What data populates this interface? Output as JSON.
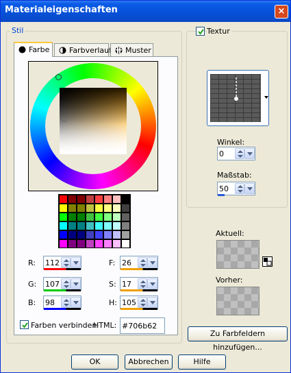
{
  "window": {
    "title": "Materialeigenschaften",
    "close": "×"
  },
  "stil": {
    "legend": "Stil",
    "tabs": [
      {
        "label": "Farbe",
        "icon": "filled-circle-icon"
      },
      {
        "label": "Farbverlauf",
        "icon": "half-circle-icon"
      },
      {
        "label": "Muster",
        "icon": "pattern-icon"
      }
    ],
    "fields": {
      "r": {
        "label": "R:",
        "value": "112",
        "bar": "#ff0000"
      },
      "g": {
        "label": "G:",
        "value": "107",
        "bar": "#00cc00"
      },
      "b": {
        "label": "B:",
        "value": "98",
        "bar": "#0000ff"
      },
      "f": {
        "label": "F:",
        "value": "26",
        "bar": "#f0a000"
      },
      "s": {
        "label": "S:",
        "value": "17",
        "bar": "#f0a000"
      },
      "h": {
        "label": "H:",
        "value": "105",
        "bar": "#f0a000"
      }
    },
    "link_colors": {
      "label": "Farben verbinden",
      "checked": true
    },
    "html": {
      "label": "HTML:",
      "value": "#706b62"
    }
  },
  "textur": {
    "label": "Textur",
    "checked": true,
    "winkel": {
      "label": "Winkel:",
      "value": "0"
    },
    "massstab": {
      "label": "Maßstab:",
      "value": "50"
    }
  },
  "aktuell": {
    "label": "Aktuell:"
  },
  "vorher": {
    "label": "Vorher:"
  },
  "buttons": {
    "add_swatches": "Zu Farbfeldern hinzufügen...",
    "ok": "OK",
    "cancel": "Abbrechen",
    "help": "Hilfe"
  },
  "palette": [
    "#ff0000",
    "#800000",
    "#800000",
    "#c04040",
    "#ff4040",
    "#ff8080",
    "#ffc0c0",
    "#000000",
    "#ffff00",
    "#808000",
    "#808000",
    "#c0c040",
    "#ffff40",
    "#ffff80",
    "#ffffc0",
    "#404040",
    "#00ff00",
    "#008000",
    "#008000",
    "#40c040",
    "#40ff40",
    "#80ff80",
    "#c0ffc0",
    "#606060",
    "#00ffff",
    "#008080",
    "#008080",
    "#40c0c0",
    "#40ffff",
    "#80ffff",
    "#c0ffff",
    "#808080",
    "#0000ff",
    "#000080",
    "#000080",
    "#4040c0",
    "#4040ff",
    "#8080ff",
    "#c0c0ff",
    "#a0a0a0",
    "#ff00ff",
    "#800080",
    "#800080",
    "#c040c0",
    "#ff40ff",
    "#ff80ff",
    "#ffc0ff",
    "#ffffff"
  ]
}
